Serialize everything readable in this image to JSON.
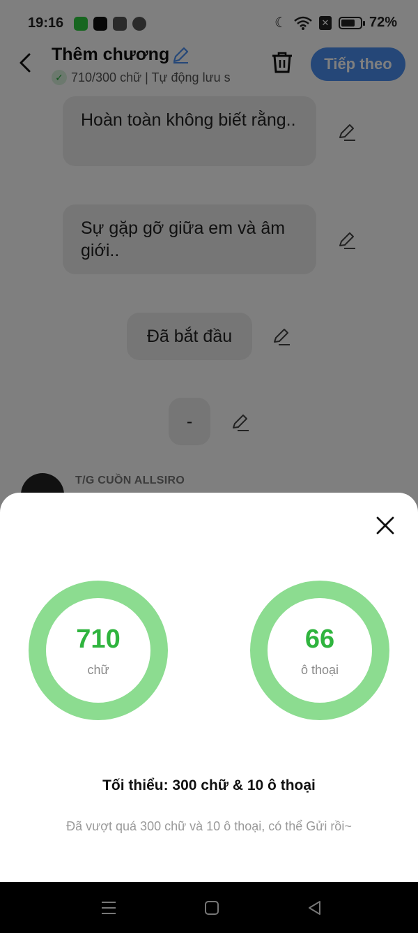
{
  "status": {
    "time": "19:16",
    "battery": "72%",
    "battery_level": 0.72
  },
  "header": {
    "title": "Thêm chương",
    "subtitle": "710/300 chữ | Tự động lưu s",
    "next_label": "Tiếp theo"
  },
  "story": {
    "bubbles": [
      "Hoàn toàn không biết rằng..",
      "Sự gặp gỡ giữa em và âm giới..",
      "Đã bắt đầu",
      "-"
    ],
    "author": "T/G CUỒN ALLSIRO"
  },
  "sheet": {
    "words_value": "710",
    "words_unit": "chữ",
    "dialogs_value": "66",
    "dialogs_unit": "ô thoại",
    "minimum": "Tối thiểu: 300 chữ & 10 ô thoại",
    "hint": "Đã vượt quá 300 chữ và 10 ô thoại, có thể Gửi rồi~"
  },
  "colors": {
    "accent": "#4a8ff0",
    "ring": "#8cdc90",
    "value": "#2fb43e"
  },
  "icons": [
    "back-arrow-icon",
    "pencil-icon",
    "trash-icon",
    "close-icon",
    "menu-icon",
    "home-icon",
    "back-triangle-icon"
  ]
}
